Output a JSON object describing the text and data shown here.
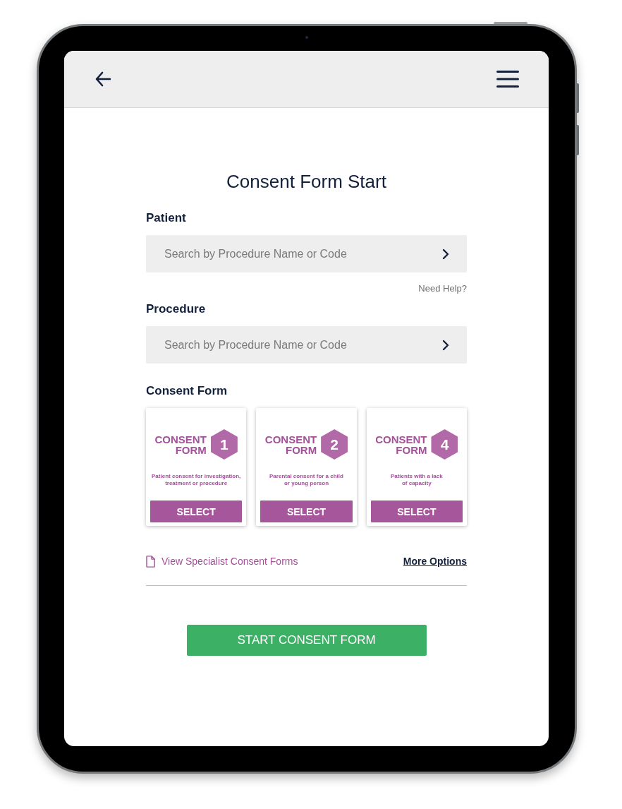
{
  "title": "Consent Form Start",
  "fields": [
    {
      "label": "Patient",
      "placeholder": "Search by Procedure Name or Code",
      "help": "Need Help?"
    },
    {
      "label": "Procedure",
      "placeholder": "Search by Procedure Name or Code"
    }
  ],
  "consent_form": {
    "label": "Consent Form",
    "cards": [
      {
        "heading": "CONSENT FORM",
        "number": "1",
        "description": "Patient consent for investigation,\ntreatment or procedure",
        "button": "SELECT"
      },
      {
        "heading": "CONSENT FORM",
        "number": "2",
        "description": "Parental consent for a child\nor young person",
        "button": "SELECT"
      },
      {
        "heading": "CONSENT FORM",
        "number": "4",
        "description": "Patients with a lack\nof capacity",
        "button": "SELECT"
      }
    ]
  },
  "links": {
    "specialist": "View Specialist Consent Forms",
    "more_options": "More Options"
  },
  "primary_button": "START CONSENT FORM"
}
